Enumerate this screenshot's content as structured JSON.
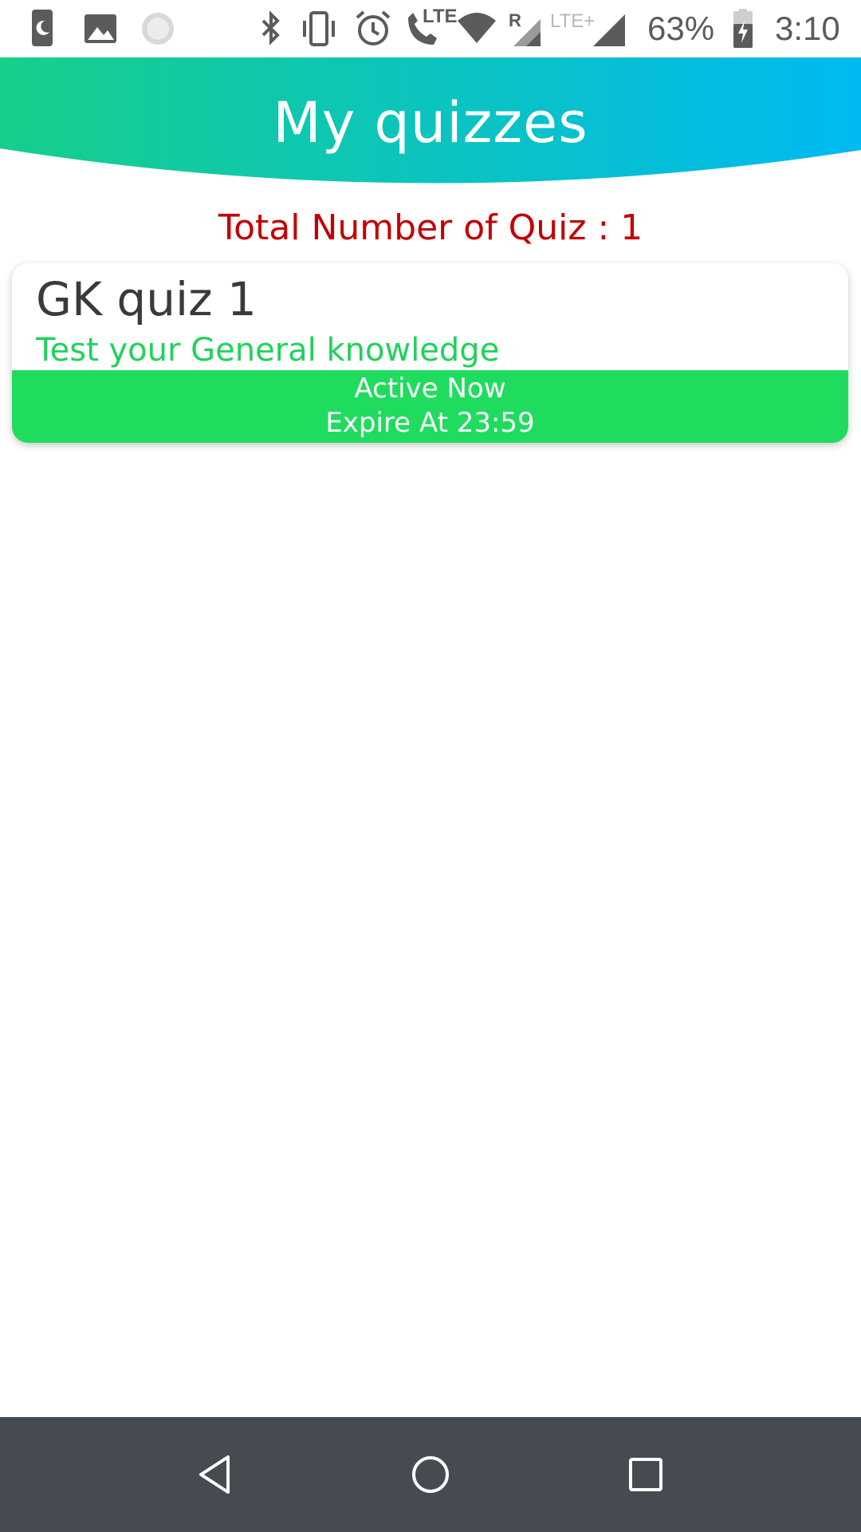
{
  "status_bar": {
    "network_type": "LTE",
    "roaming_indicator": "R",
    "secondary_network": "LTE+",
    "battery_percent": "63%",
    "time": "3:10",
    "icons": [
      "moon-icon",
      "image-icon",
      "loading-icon",
      "bluetooth-icon",
      "vibrate-icon",
      "alarm-icon",
      "volte-call-icon",
      "wifi-icon",
      "signal-icon",
      "battery-charging-icon"
    ]
  },
  "header": {
    "title": "My quizzes",
    "gradient_start": "#16cf8a",
    "gradient_end": "#00b9f2"
  },
  "summary": {
    "total_label": "Total Number of Quiz : 1",
    "color": "#c40000"
  },
  "quizzes": [
    {
      "title": "GK quiz 1",
      "description": "Test your General knowledge",
      "status": "Active Now",
      "expiry": "Expire At 23:59",
      "status_color": "#20dc5e"
    }
  ],
  "nav_bar": {
    "background": "#454b51",
    "buttons": [
      "back-icon",
      "home-icon",
      "recents-icon"
    ]
  }
}
